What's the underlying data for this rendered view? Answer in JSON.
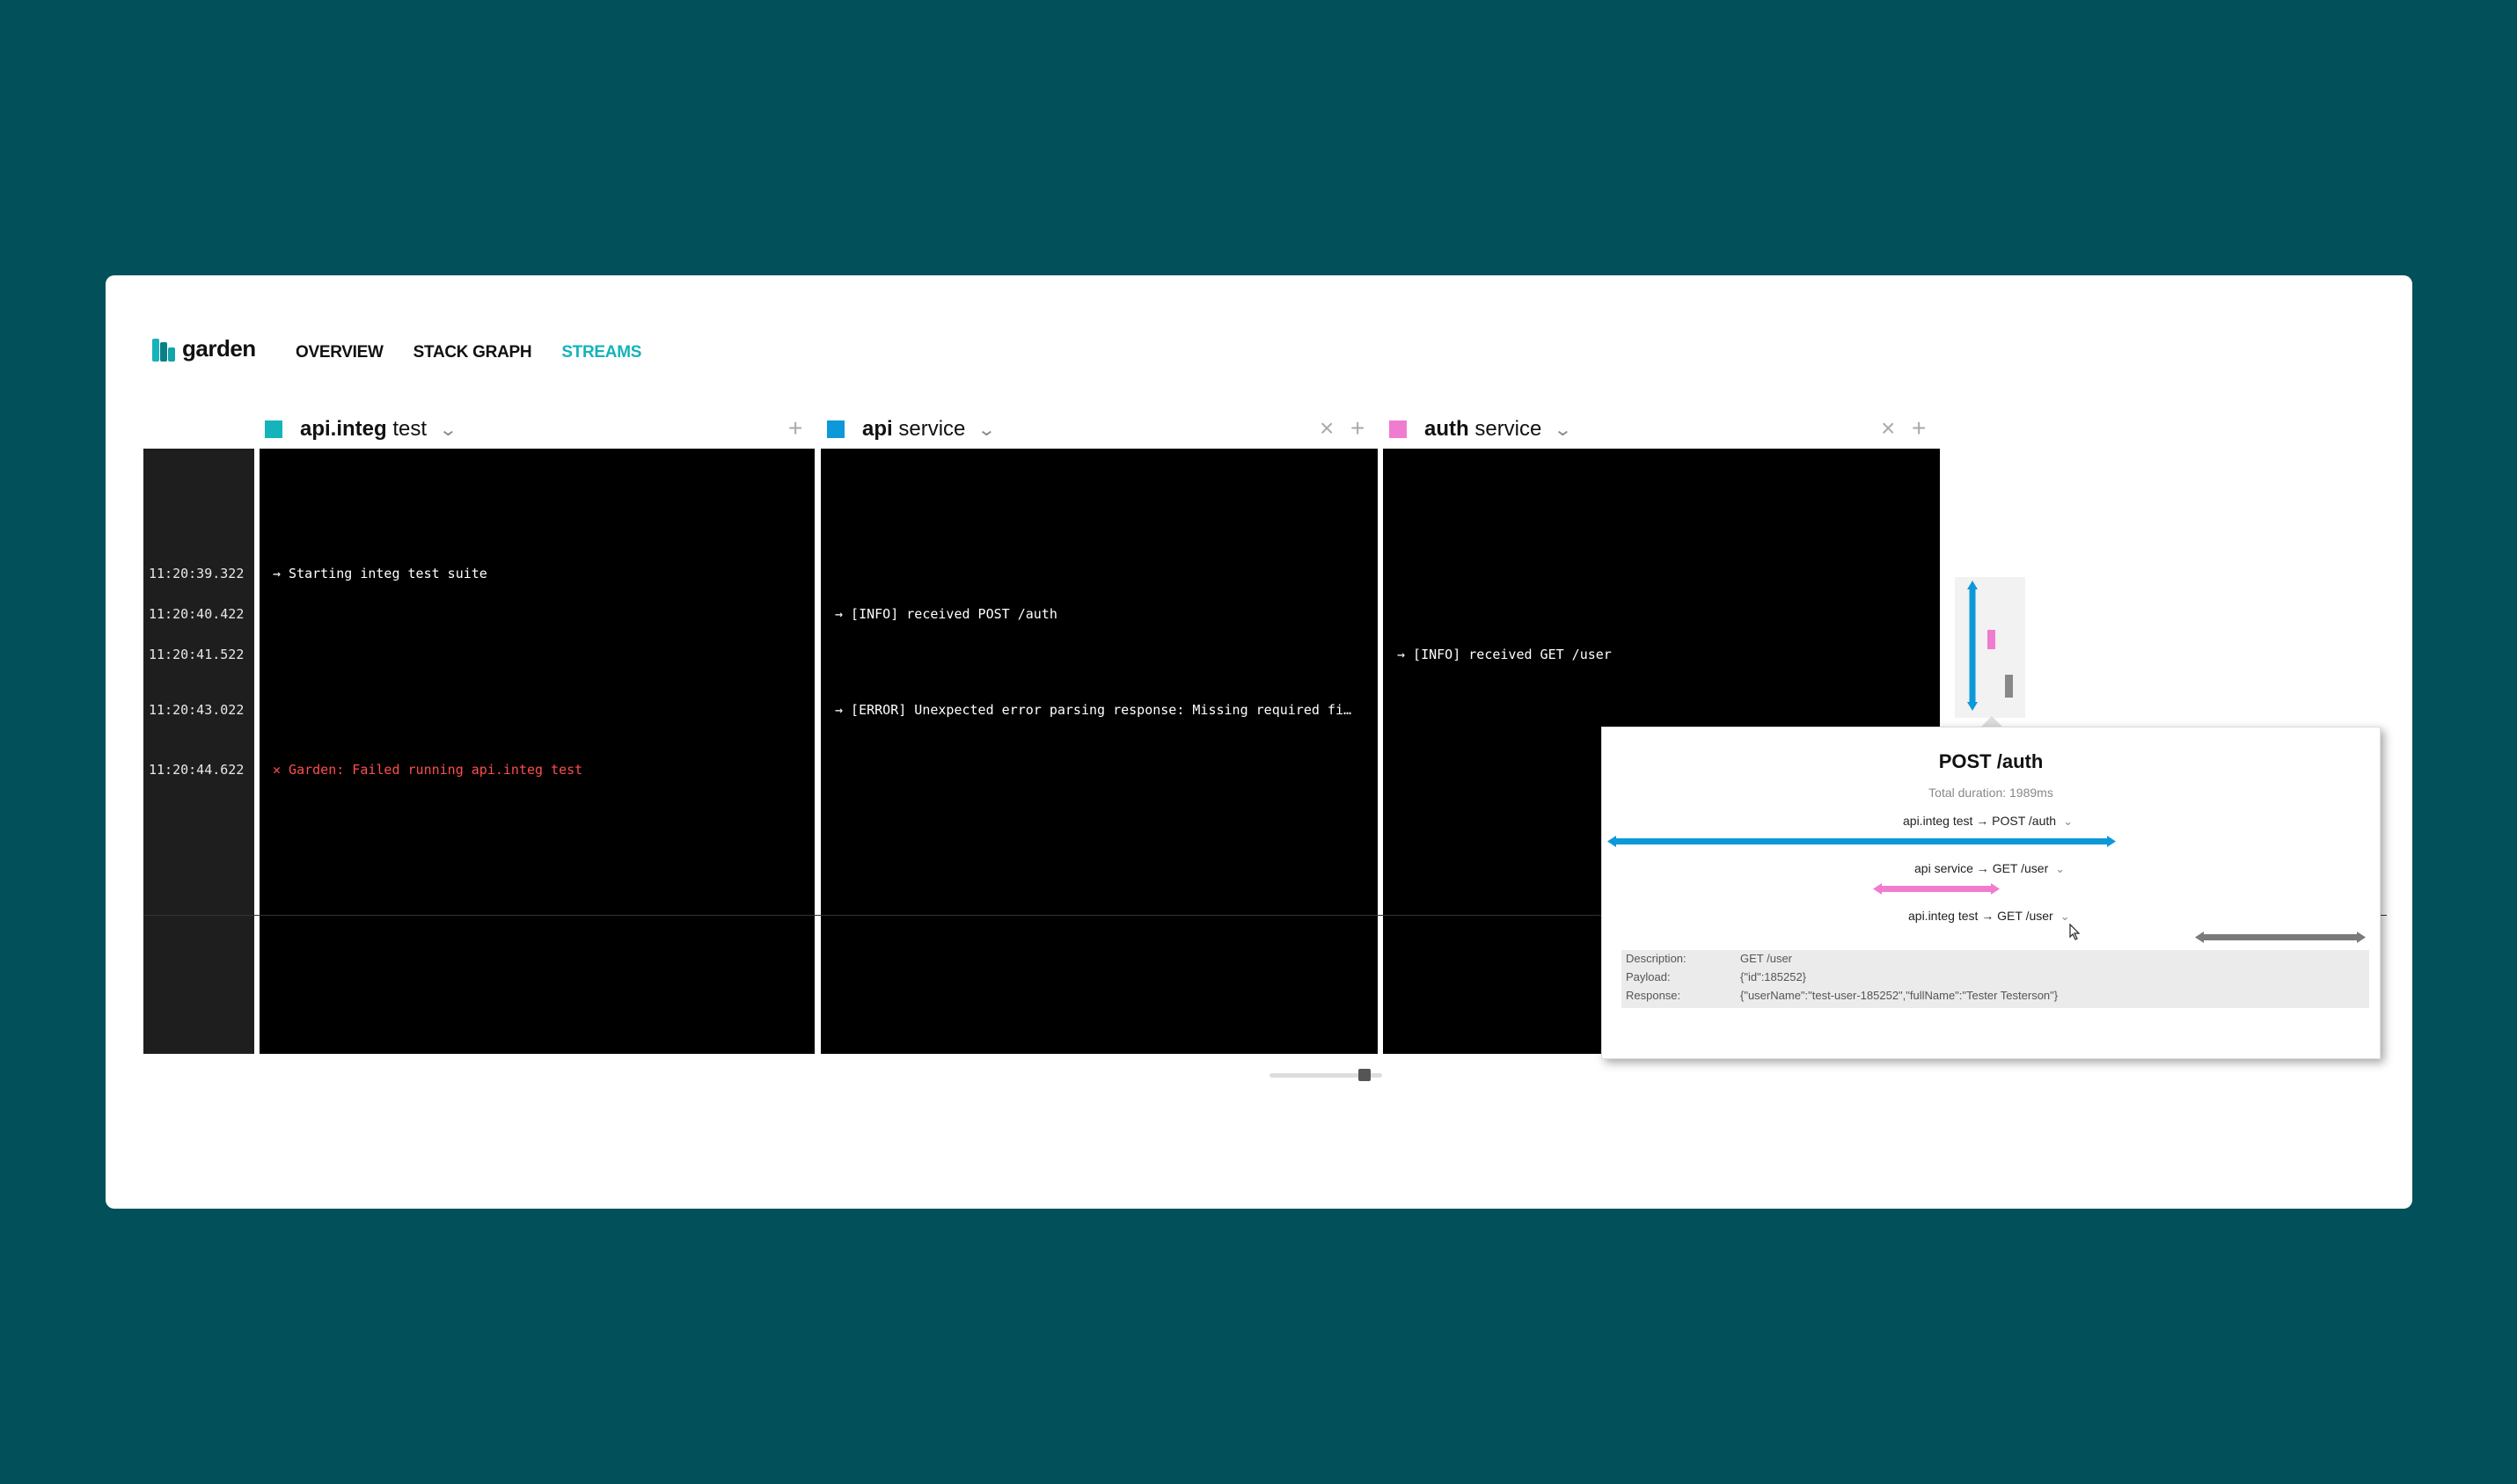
{
  "app": {
    "logo_text": "garden",
    "nav": [
      {
        "label": "OVERVIEW",
        "active": false
      },
      {
        "label": "STACK GRAPH",
        "active": false
      },
      {
        "label": "STREAMS",
        "active": true
      }
    ],
    "accent": "#15b3ba"
  },
  "streams": [
    {
      "name_bold": "api.integ",
      "name_rest": "test",
      "color": "#15b3ba",
      "has_close": false
    },
    {
      "name_bold": "api",
      "name_rest": "service",
      "color": "#0d98d8",
      "has_close": true
    },
    {
      "name_bold": "auth",
      "name_rest": "service",
      "color": "#f07ccf",
      "has_close": true
    }
  ],
  "timestamps": [
    "11:20:39.322",
    "11:20:40.422",
    "11:20:41.522",
    "11:20:43.022",
    "11:20:44.622"
  ],
  "logs": {
    "integ_1": "→ Starting integ test suite",
    "integ_2": "✕ Garden: Failed running api.integ test",
    "api_1": "→ [INFO] received POST /auth",
    "api_2": "→ [ERROR] Unexpected error parsing response: Missing required fi…",
    "auth_1": "→ [INFO] received GET /user"
  },
  "popover": {
    "title": "POST /auth",
    "duration": "Total duration: 1989ms",
    "spans": [
      {
        "label": "api.integ test → POST /auth",
        "color": "#0d98d8"
      },
      {
        "label": "api service → GET /user",
        "color": "#f07ccf"
      },
      {
        "label": "api.integ test → GET /user",
        "color": "#7a7a7a"
      }
    ],
    "details": [
      {
        "key": "Description:",
        "value": "GET /user"
      },
      {
        "key": "Payload:",
        "value": "{\"id\":185252}"
      },
      {
        "key": "Response:",
        "value": "{\"userName\":\"test-user-185252\",\"fullName\":\"Tester Testerson\"}"
      }
    ]
  },
  "icons": {
    "add": "+",
    "close": "×",
    "chevron": "⌄"
  }
}
